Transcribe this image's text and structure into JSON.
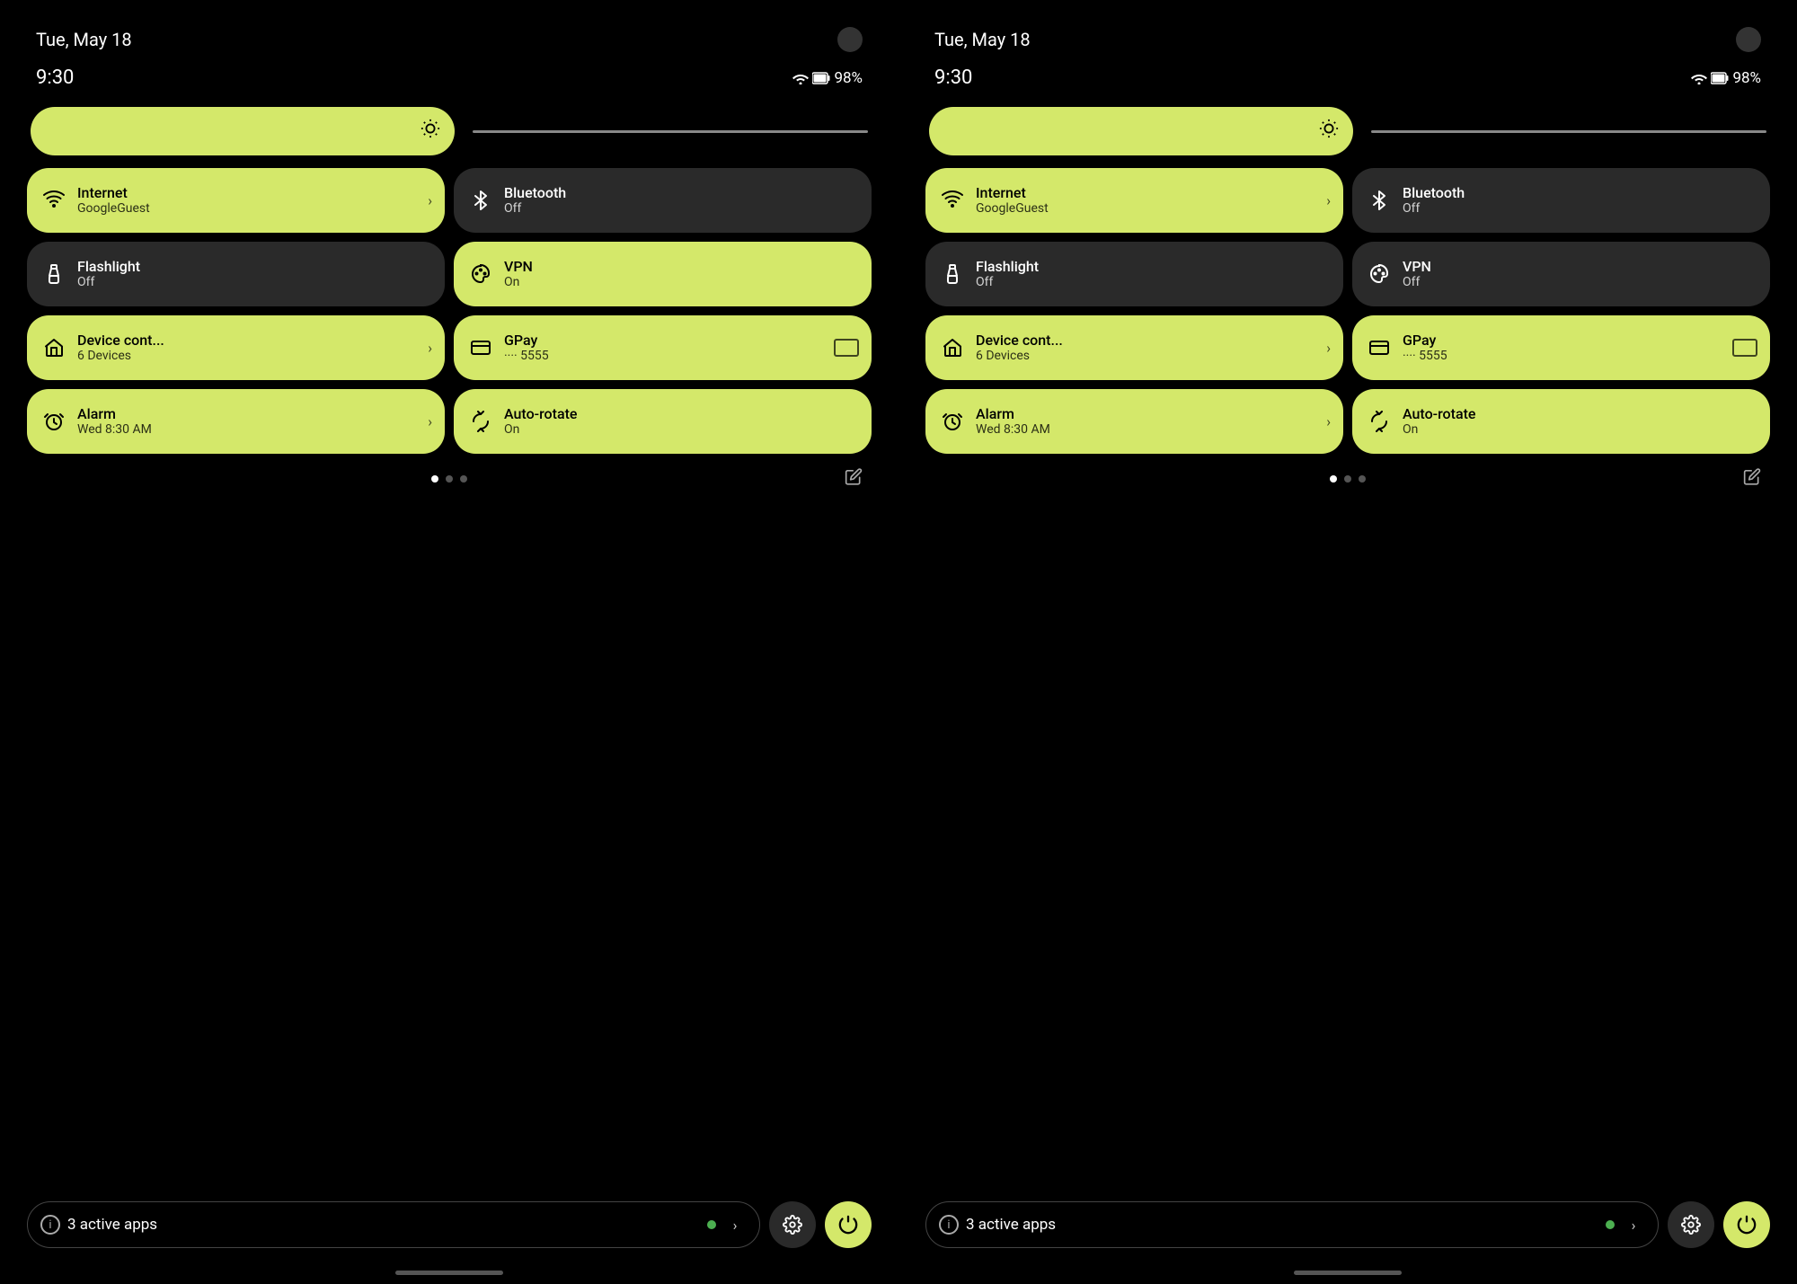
{
  "colors": {
    "active_tile": "#d4e86a",
    "inactive_tile": "#2a2a2a",
    "bg": "#000000",
    "green_dot": "#4caf50"
  },
  "panels": [
    {
      "id": "left",
      "status_bar": {
        "date": "Tue, May 18",
        "time": "9:30",
        "battery": "98%"
      },
      "brightness": {},
      "tiles": [
        {
          "id": "internet",
          "title": "Internet",
          "subtitle": "GoogleGuest",
          "active": true,
          "has_arrow": true,
          "icon": "wifi"
        },
        {
          "id": "bluetooth",
          "title": "Bluetooth",
          "subtitle": "Off",
          "active": false,
          "has_arrow": false,
          "icon": "bluetooth"
        },
        {
          "id": "flashlight",
          "title": "Flashlight",
          "subtitle": "Off",
          "active": false,
          "has_arrow": false,
          "icon": "flashlight"
        },
        {
          "id": "vpn",
          "title": "VPN",
          "subtitle": "On",
          "active": true,
          "has_arrow": false,
          "icon": "vpn"
        },
        {
          "id": "device-control",
          "title": "Device cont...",
          "subtitle": "6 Devices",
          "active": true,
          "has_arrow": true,
          "icon": "home"
        },
        {
          "id": "gpay",
          "title": "GPay",
          "subtitle": "···· 5555",
          "active": true,
          "has_arrow": false,
          "icon": "gpay",
          "has_card": true
        },
        {
          "id": "alarm",
          "title": "Alarm",
          "subtitle": "Wed 8:30 AM",
          "active": true,
          "has_arrow": true,
          "icon": "alarm"
        },
        {
          "id": "auto-rotate",
          "title": "Auto-rotate",
          "subtitle": "On",
          "active": true,
          "has_arrow": false,
          "icon": "rotate"
        }
      ],
      "pagination": {
        "active_dot": 0,
        "total_dots": 3
      },
      "bottom": {
        "active_apps_count": "3",
        "active_apps_label": "active apps"
      }
    },
    {
      "id": "right",
      "status_bar": {
        "date": "Tue, May 18",
        "time": "9:30",
        "battery": "98%"
      },
      "brightness": {},
      "tiles": [
        {
          "id": "internet",
          "title": "Internet",
          "subtitle": "GoogleGuest",
          "active": true,
          "has_arrow": true,
          "icon": "wifi"
        },
        {
          "id": "bluetooth",
          "title": "Bluetooth",
          "subtitle": "Off",
          "active": false,
          "has_arrow": false,
          "icon": "bluetooth"
        },
        {
          "id": "flashlight",
          "title": "Flashlight",
          "subtitle": "Off",
          "active": false,
          "has_arrow": false,
          "icon": "flashlight"
        },
        {
          "id": "vpn",
          "title": "VPN",
          "subtitle": "Off",
          "active": false,
          "has_arrow": false,
          "icon": "vpn"
        },
        {
          "id": "device-control",
          "title": "Device cont...",
          "subtitle": "6 Devices",
          "active": true,
          "has_arrow": true,
          "icon": "home"
        },
        {
          "id": "gpay",
          "title": "GPay",
          "subtitle": "···· 5555",
          "active": true,
          "has_arrow": false,
          "icon": "gpay",
          "has_card": true
        },
        {
          "id": "alarm",
          "title": "Alarm",
          "subtitle": "Wed 8:30 AM",
          "active": true,
          "has_arrow": true,
          "icon": "alarm"
        },
        {
          "id": "auto-rotate",
          "title": "Auto-rotate",
          "subtitle": "On",
          "active": true,
          "has_arrow": false,
          "icon": "rotate"
        }
      ],
      "pagination": {
        "active_dot": 0,
        "total_dots": 3
      },
      "bottom": {
        "active_apps_count": "3",
        "active_apps_label": "active apps"
      }
    }
  ]
}
